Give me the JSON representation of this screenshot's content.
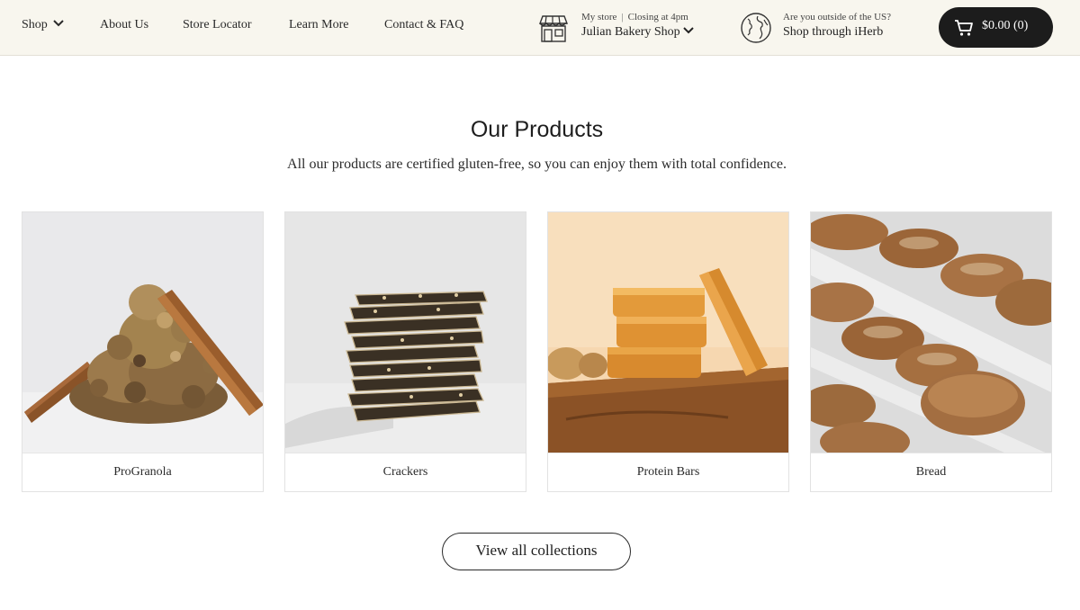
{
  "header": {
    "nav": [
      {
        "label": "Shop"
      },
      {
        "label": "About Us"
      },
      {
        "label": "Store Locator"
      },
      {
        "label": "Learn More"
      },
      {
        "label": "Contact & FAQ"
      }
    ],
    "store": {
      "label": "My store",
      "hours": "Closing at 4pm",
      "name": "Julian Bakery Shop",
      "icon": "storefront-icon"
    },
    "international": {
      "question": "Are you outside of the US?",
      "link": "Shop through iHerb",
      "icon": "globe-icon"
    },
    "cart": {
      "label": "$0.00 (0)",
      "icon": "cart-icon"
    }
  },
  "main": {
    "title": "Our Products",
    "subtitle": "All our products are certified gluten-free, so you can enjoy them with total confidence.",
    "products": [
      {
        "label": "ProGranola"
      },
      {
        "label": "Crackers"
      },
      {
        "label": "Protein Bars"
      },
      {
        "label": "Bread"
      }
    ],
    "view_all": "View all collections"
  },
  "colors": {
    "header_bg": "#f8f6ee",
    "cart_bg": "#1c1c1c",
    "text": "#222222"
  }
}
